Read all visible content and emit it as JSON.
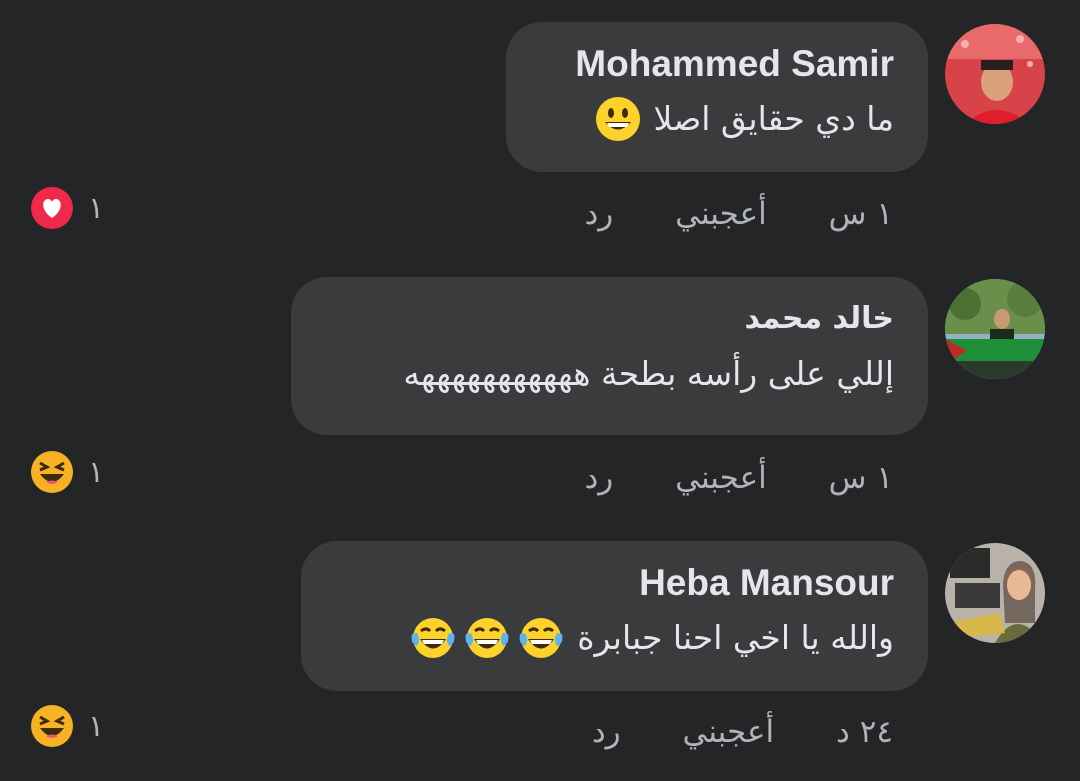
{
  "comments": [
    {
      "author": "Mohammed Samir",
      "text": "ما دي حقايق اصلا",
      "emojis": [
        "grinning-face-icon"
      ],
      "time": "١ س",
      "like_label": "أعجبني",
      "reply_label": "رد",
      "reaction": {
        "icon": "love-reaction-icon",
        "count": "١"
      }
    },
    {
      "author": "خالد محمد",
      "text": "إللي على رأسه بطحة هههههههههههه",
      "emojis": [],
      "time": "١ س",
      "like_label": "أعجبني",
      "reply_label": "رد",
      "reaction": {
        "icon": "haha-reaction-icon",
        "count": "١"
      }
    },
    {
      "author": "Heba Mansour",
      "text": "والله يا اخي احنا جبابرة",
      "emojis": [
        "tears-of-joy-icon",
        "tears-of-joy-icon",
        "tears-of-joy-icon"
      ],
      "time": "٢٤ د",
      "like_label": "أعجبني",
      "reply_label": "رد",
      "reaction": {
        "icon": "haha-reaction-icon",
        "count": "١"
      }
    }
  ],
  "colors": {
    "background": "#242526",
    "bubble": "#3a3b3c",
    "text": "#e4e6eb",
    "meta": "#b0b3b8",
    "love": "#f02849",
    "haha": "#f7b125"
  }
}
